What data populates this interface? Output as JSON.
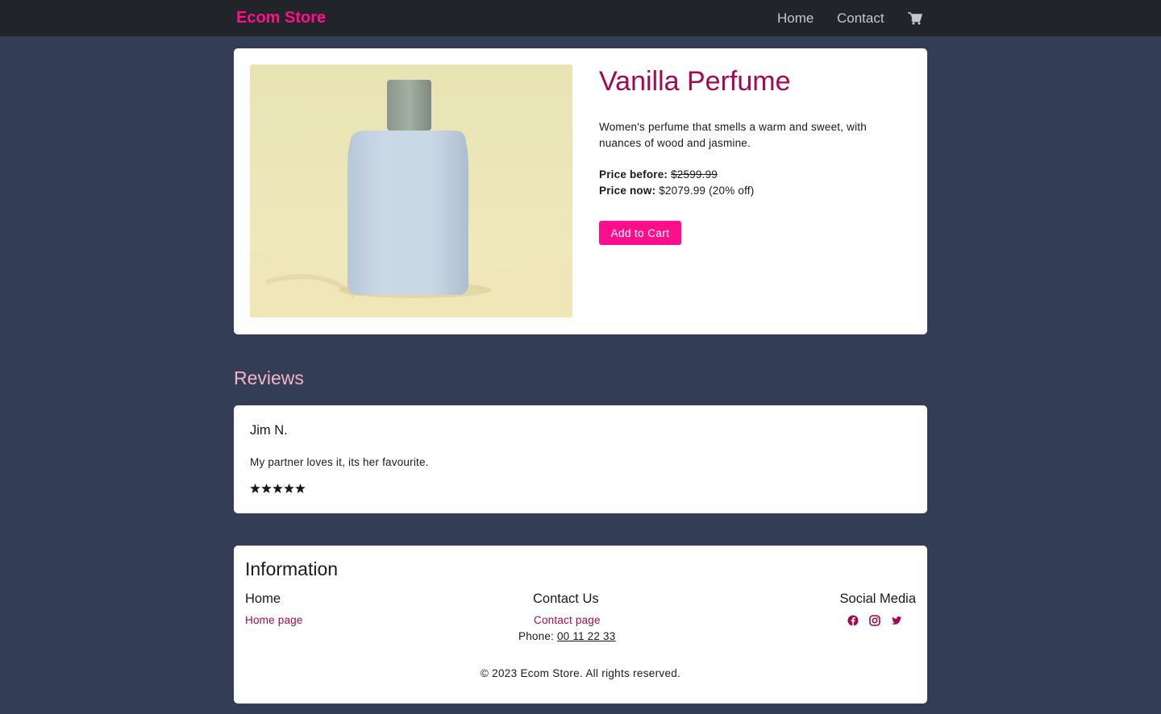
{
  "navbar": {
    "brand": "Ecom Store",
    "home_label": "Home",
    "contact_label": "Contact",
    "cart_icon": "shopping-cart-icon"
  },
  "product": {
    "title": "Vanilla Perfume",
    "description": "Women's perfume that smells a warm and sweet, with nuances of wood and jasmine.",
    "price_before_label": "Price before:",
    "price_before_value": "$2599.99",
    "price_now_label": "Price now:",
    "price_now_value": "$2079.99",
    "discount": "(20% off)",
    "add_to_cart_label": "Add to Cart"
  },
  "reviews": {
    "heading": "Reviews",
    "items": [
      {
        "author": "Jim N.",
        "text": "My partner loves it, its her favourite.",
        "rating": 5
      }
    ]
  },
  "footer": {
    "title": "Information",
    "home_heading": "Home",
    "home_link": "Home page",
    "contact_heading": "Contact Us",
    "contact_link": "Contact page",
    "phone_label": "Phone:",
    "phone_number": "00 11 22 33",
    "social_heading": "Social Media",
    "social_icons": [
      "facebook-icon",
      "instagram-icon",
      "twitter-icon"
    ],
    "copyright": "© 2023 Ecom Store. All rights reserved."
  },
  "colors": {
    "brand": "#ff0f8b",
    "title": "#a3094f",
    "background": "#333e56",
    "navbar": "#212529",
    "reviews_heading": "#f4b4c8"
  }
}
